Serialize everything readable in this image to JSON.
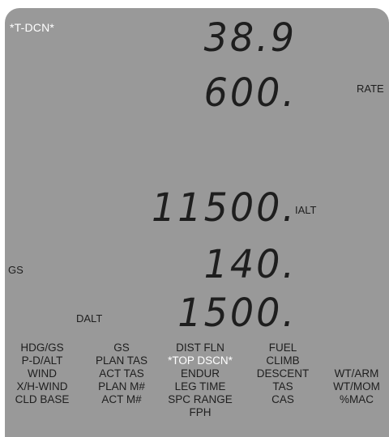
{
  "display": {
    "mode_indicator": "*T-DCN*",
    "row1_value": "38.9",
    "row2_value": "600.",
    "row2_unit": "RATE",
    "row3_value": "11500.",
    "row3_unit": "IALT",
    "row4_value": "140.",
    "row4_unit": "GS",
    "row5_value": "1500.",
    "row5_unit": "DALT"
  },
  "function_labels": {
    "col1": [
      "HDG/GS",
      "P-D/ALT",
      "WIND",
      "X/H-WIND",
      "CLD BASE"
    ],
    "col2": [
      "GS",
      "PLAN TAS",
      "ACT TAS",
      "PLAN M#",
      "ACT M#"
    ],
    "col3": [
      "DIST FLN",
      "*TOP DSCN*",
      "ENDUR",
      "LEG TIME",
      "SPC RANGE",
      "FPH"
    ],
    "col4": [
      "FUEL",
      "CLIMB",
      "DESCENT",
      "TAS",
      "CAS"
    ],
    "col5": [
      "WT/ARM",
      "WT/MOM",
      "%MAC"
    ]
  },
  "colors": {
    "lcd_background": "#999999",
    "segment_text": "#1e1e1e",
    "highlight_text": "#ffffff"
  }
}
